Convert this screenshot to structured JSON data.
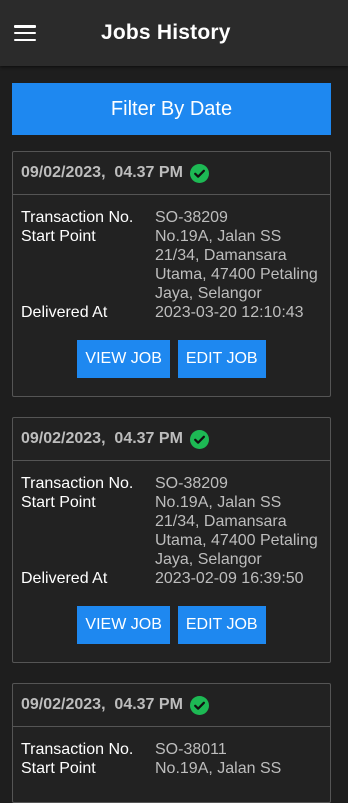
{
  "appbar": {
    "title": "Jobs History",
    "menu_icon": "hamburger-menu-icon"
  },
  "filter_button": {
    "label": "Filter By Date"
  },
  "colors": {
    "accent": "#1e88f0",
    "check": "#1db954",
    "background": "#1e1e1e"
  },
  "jobs": [
    {
      "date": "09/02/2023,  04.37 PM",
      "transaction_label": "Transaction No.",
      "transaction_no": "SO-38209",
      "start_label": "Start Point",
      "start_point": "No.19A, Jalan SS 21/34, Damansara Utama, 47400 Petaling Jaya, Selangor",
      "delivered_label": "Delivered At",
      "delivered_at": "2023-03-20 12:10:43",
      "view_label": "VIEW JOB",
      "edit_label": "EDIT JOB"
    },
    {
      "date": "09/02/2023,  04.37 PM",
      "transaction_label": "Transaction No.",
      "transaction_no": "SO-38209",
      "start_label": "Start Point",
      "start_point": "No.19A, Jalan SS 21/34, Damansara Utama, 47400 Petaling Jaya, Selangor",
      "delivered_label": "Delivered At",
      "delivered_at": "2023-02-09 16:39:50",
      "view_label": "VIEW JOB",
      "edit_label": "EDIT JOB"
    },
    {
      "date": "09/02/2023,  04.37 PM",
      "transaction_label": "Transaction No.",
      "transaction_no": "SO-38011",
      "start_label": "Start Point",
      "start_point": "No.19A, Jalan SS"
    }
  ]
}
